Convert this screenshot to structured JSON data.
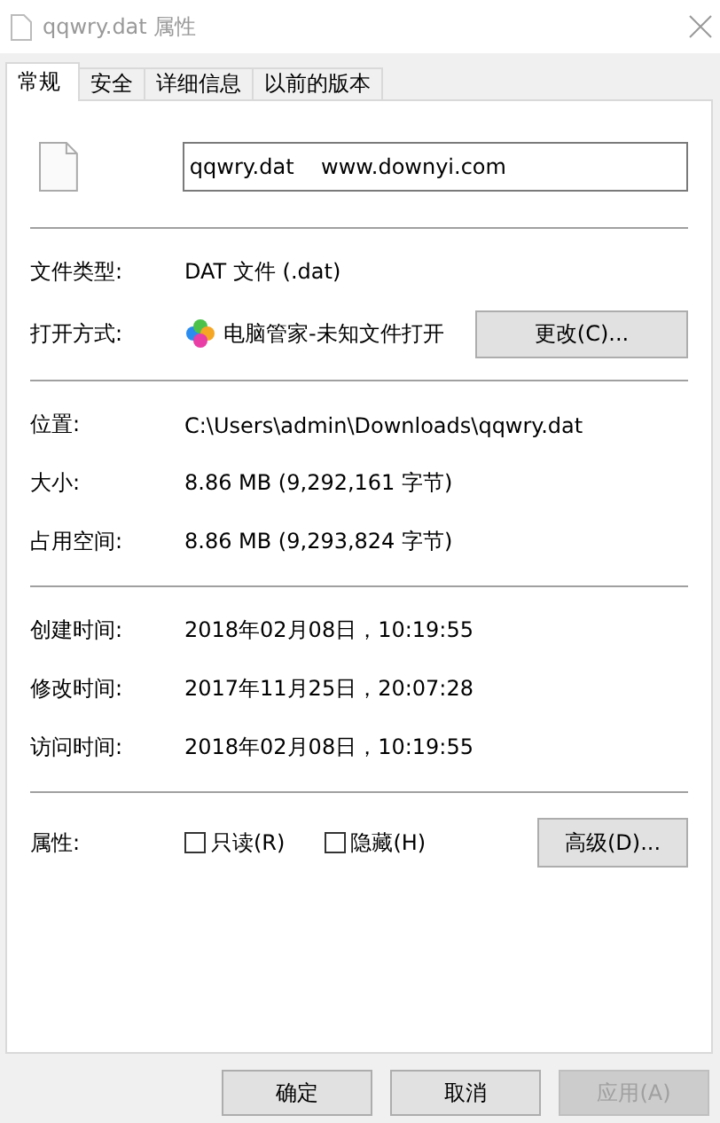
{
  "window": {
    "title": "qqwry.dat 属性"
  },
  "tabs": [
    {
      "label": "常规",
      "selected": true
    },
    {
      "label": "安全",
      "selected": false
    },
    {
      "label": "详细信息",
      "selected": false
    },
    {
      "label": "以前的版本",
      "selected": false
    }
  ],
  "name_field": {
    "value": "qqwry.dat    www.downyi.com"
  },
  "groups": [
    [
      {
        "kind": "text",
        "label": "文件类型:",
        "value": "DAT 文件 (.dat)"
      },
      {
        "kind": "app",
        "label": "打开方式:",
        "value": "电脑管家-未知文件打开",
        "button": "更改(C)..."
      }
    ],
    [
      {
        "kind": "text",
        "label": "位置:",
        "value": "C:\\Users\\admin\\Downloads\\qqwry.dat"
      },
      {
        "kind": "text",
        "label": "大小:",
        "value": "8.86 MB (9,292,161 字节)"
      },
      {
        "kind": "text",
        "label": "占用空间:",
        "value": "8.86 MB (9,293,824 字节)"
      }
    ],
    [
      {
        "kind": "text",
        "label": "创建时间:",
        "value": "2018年02月08日，10:19:55"
      },
      {
        "kind": "text",
        "label": "修改时间:",
        "value": "2017年11月25日，20:07:28"
      },
      {
        "kind": "text",
        "label": "访问时间:",
        "value": "2018年02月08日，10:19:55"
      }
    ]
  ],
  "attributes": {
    "label": "属性:",
    "checkboxes": [
      {
        "label": "只读(R)",
        "checked": false
      },
      {
        "label": "隐藏(H)",
        "checked": false
      }
    ],
    "button": "高级(D)..."
  },
  "buttons": [
    {
      "label": "确定",
      "disabled": false
    },
    {
      "label": "取消",
      "disabled": false
    },
    {
      "label": "应用(A)",
      "disabled": true
    }
  ]
}
